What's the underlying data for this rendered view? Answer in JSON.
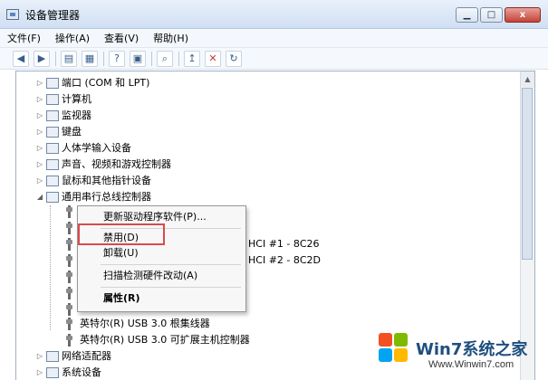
{
  "window": {
    "title": "设备管理器"
  },
  "window_buttons": {
    "minimize": "▁",
    "maximize": "□",
    "close": "x"
  },
  "menu": [
    {
      "label": "文件(F)"
    },
    {
      "label": "操作(A)"
    },
    {
      "label": "查看(V)"
    },
    {
      "label": "帮助(H)"
    }
  ],
  "toolbar_icons": [
    "back-arrow-icon",
    "forward-arrow-icon",
    "properties-icon",
    "details-view-icon",
    "help-question-icon",
    "small-view-icon",
    "scan-hardware-icon",
    "update-driver-icon",
    "uninstall-x-icon",
    "disable-device-icon"
  ],
  "tree": {
    "categories": [
      {
        "label": "端口 (COM 和 LPT)"
      },
      {
        "label": "计算机"
      },
      {
        "label": "监视器"
      },
      {
        "label": "键盘"
      },
      {
        "label": "人体学输入设备"
      },
      {
        "label": "声音、视频和游戏控制器"
      },
      {
        "label": "鼠标和其他指针设备"
      },
      {
        "label": "通用串行总线控制器"
      }
    ],
    "partial_entries": [
      {
        "label": "HCI #1 - 8C26"
      },
      {
        "label": "HCI #2 - 8C2D"
      }
    ],
    "usb_children": [
      {
        "label": "英特尔(R) USB 3.0 根集线器"
      },
      {
        "label": "英特尔(R) USB 3.0 可扩展主机控制器"
      }
    ],
    "bottom_categories": [
      {
        "label": "网络适配器"
      },
      {
        "label": "系统设备"
      }
    ]
  },
  "context_menu": [
    {
      "label": "更新驱动程序软件(P)..."
    },
    {
      "label": "禁用(D)"
    },
    {
      "label": "卸载(U)"
    },
    {
      "label": "扫描检测硬件改动(A)"
    },
    {
      "label": "属性(R)"
    }
  ],
  "watermark": {
    "brand": "Win7系统之家",
    "url": "Www.Winwin7.com"
  },
  "colors": {
    "highlight": "#d94a4a",
    "accent": "#1f4f7e"
  }
}
